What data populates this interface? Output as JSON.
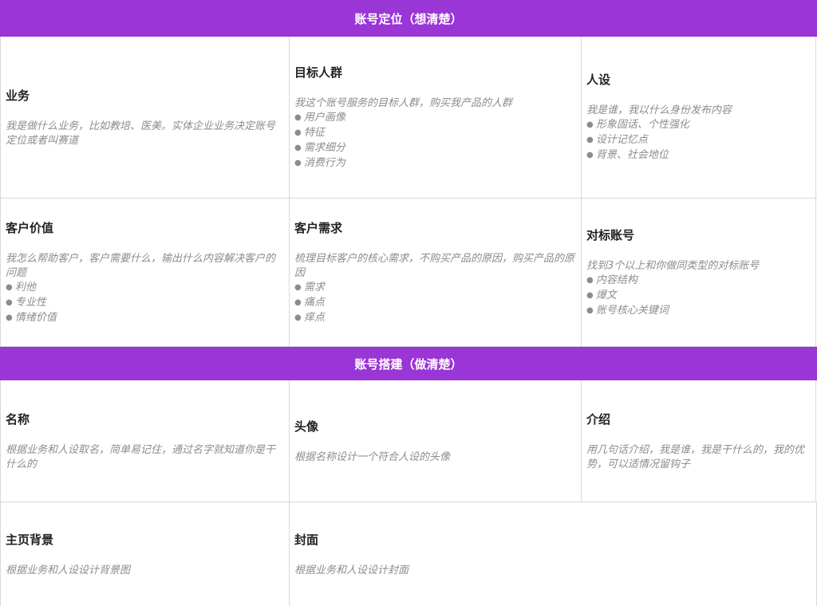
{
  "sections": [
    {
      "title": "账号定位（想清楚）",
      "rows": [
        [
          {
            "title": "业务",
            "desc": "我是做什么业务，比如教培、医美。实体企业业务决定账号定位或者叫赛道",
            "bullets": []
          },
          {
            "title": "目标人群",
            "desc": "我这个账号服务的目标人群，购买我产品的人群",
            "bullets": [
              "用户画像",
              "特征",
              "需求细分",
              "消费行为"
            ]
          },
          {
            "title": "人设",
            "desc": "我是谁，我以什么身份发布内容",
            "bullets": [
              "形象固话、个性强化",
              "设计记忆点",
              "背景、社会地位"
            ]
          }
        ],
        [
          {
            "title": "客户价值",
            "desc": "我怎么帮助客户，客户需要什么，输出什么内容解决客户的问题",
            "bullets": [
              "利他",
              "专业性",
              "情绪价值"
            ]
          },
          {
            "title": "客户需求",
            "desc": "梳理目标客户的核心需求，不购买产品的原因，购买产品的原因",
            "bullets": [
              "需求",
              "痛点",
              "痒点"
            ]
          },
          {
            "title": "对标账号",
            "desc": "找到3个以上和你做同类型的对标账号",
            "bullets": [
              "内容结构",
              "爆文",
              "账号核心关键词"
            ]
          }
        ]
      ]
    },
    {
      "title": "账号搭建（做清楚）",
      "rows": [
        [
          {
            "title": "名称",
            "desc": "根据业务和人设取名，简单易记住，通过名字就知道你是干什么的",
            "bullets": []
          },
          {
            "title": "头像",
            "desc": "根据名称设计一个符合人设的头像",
            "bullets": []
          },
          {
            "title": "介绍",
            "desc": "用几句话介绍，我是谁，我是干什么的，我的优势，可以适情况留钩子",
            "bullets": []
          }
        ],
        [
          {
            "title": "主页背景",
            "desc": "根据业务和人设设计背景图",
            "bullets": []
          },
          {
            "title": "封面",
            "desc": "根据业务和人设设计封面",
            "bullets": []
          }
        ]
      ]
    }
  ]
}
